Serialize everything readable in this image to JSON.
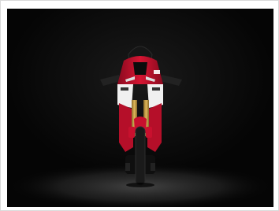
{
  "image": {
    "subject": "motorcycle",
    "alt": "",
    "colors": {
      "background": "#050505",
      "floor_glow": "#3a3a3a",
      "fairing_red": "#c8102e",
      "fairing_white": "#f2f2f2",
      "windscreen": "#141414",
      "fork_gold": "#c9a24a",
      "tyre": "#1a1a1a"
    }
  }
}
